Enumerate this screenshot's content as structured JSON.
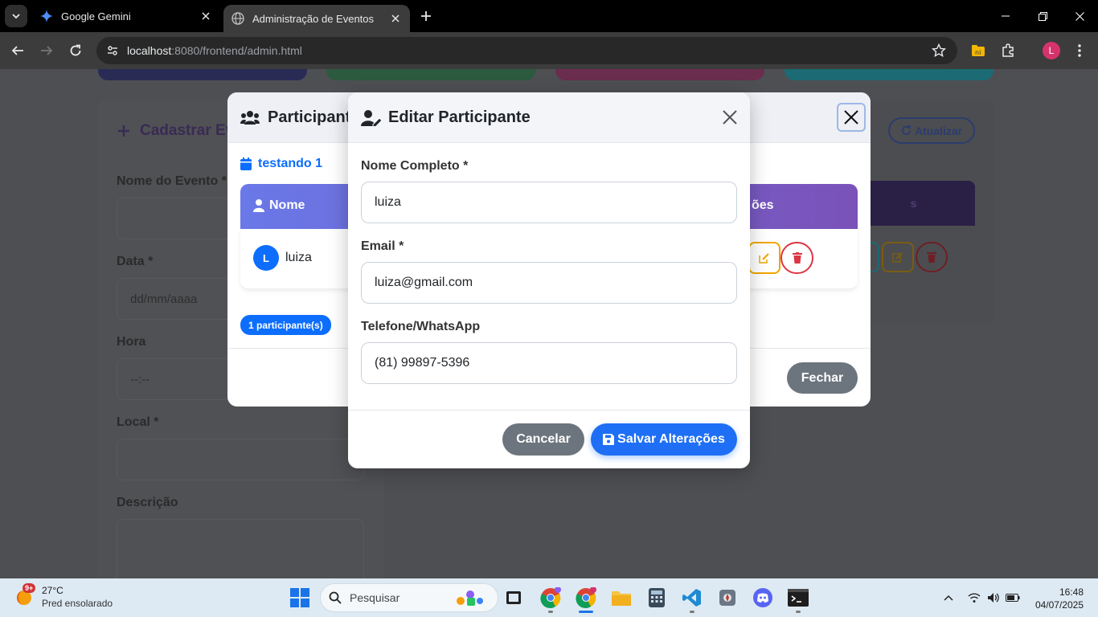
{
  "browser": {
    "tabs": [
      {
        "title": "Google Gemini",
        "active": false
      },
      {
        "title": "Administração de Eventos",
        "active": true
      }
    ],
    "url_host": "localhost",
    "url_path": ":8080/frontend/admin.html",
    "profile_initial": "L"
  },
  "page": {
    "form_title": "Cadastrar Ev",
    "fields": {
      "nome_label": "Nome do Evento *",
      "data_label": "Data *",
      "data_placeholder": "dd/mm/aaaa",
      "hora_label": "Hora",
      "hora_placeholder": "--:--",
      "local_label": "Local *",
      "descricao_label": "Descrição"
    },
    "refresh_label": "Atualizar",
    "bg_table_header": "s"
  },
  "participants_modal": {
    "title": "Participantes",
    "event_name": "testando 1",
    "col_nome": "Nome",
    "col_acoes": "ões",
    "rows": [
      {
        "initial": "L",
        "name": "luiza"
      }
    ],
    "count_badge": "1 participante(s)",
    "close_label": "Fechar"
  },
  "edit_modal": {
    "title": "Editar Participante",
    "nome_label": "Nome Completo *",
    "nome_value": "luiza",
    "email_label": "Email *",
    "email_value": "luiza@gmail.com",
    "telefone_label": "Telefone/WhatsApp",
    "telefone_value": "(81) 99897-5396",
    "cancel_label": "Cancelar",
    "save_label": "Salvar Alterações"
  },
  "taskbar": {
    "weather_temp": "27°C",
    "weather_desc": "Pred ensolarado",
    "weather_badge": "9+",
    "search_placeholder": "Pesquisar",
    "time": "16:48",
    "date": "04/07/2025"
  },
  "colors": {
    "primary": "#0d6efd",
    "header_gradient_start": "#6a78e8",
    "header_gradient_end": "#7a52b8",
    "secondary": "#6c757d",
    "warning": "#f0a500",
    "danger": "#dc3545"
  }
}
